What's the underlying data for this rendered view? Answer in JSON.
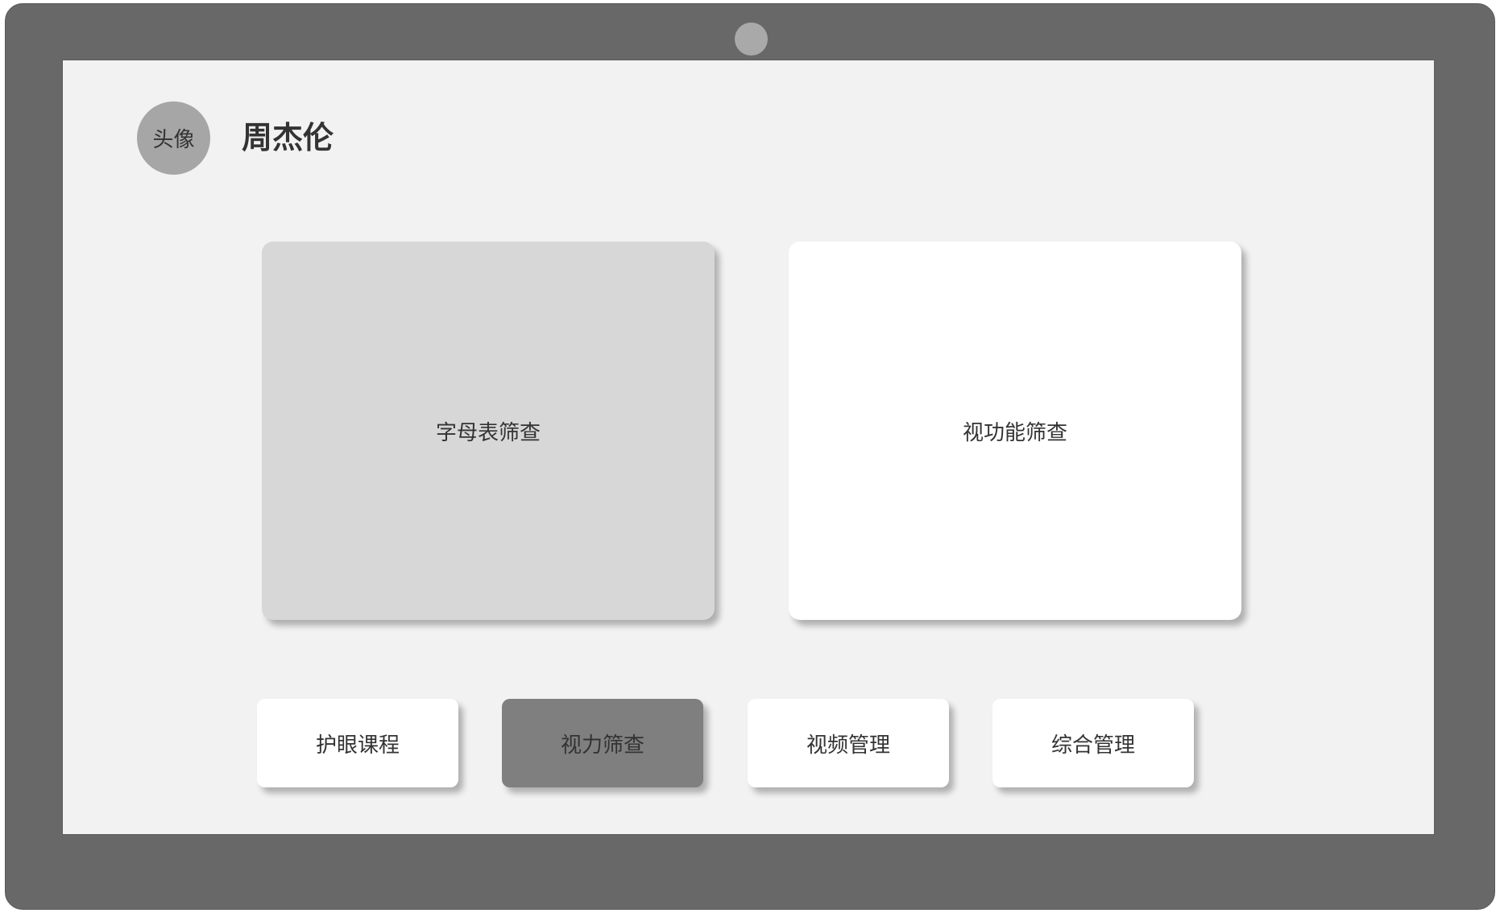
{
  "header": {
    "avatar_label": "头像",
    "username": "周杰伦"
  },
  "cards": [
    {
      "label": "字母表筛查",
      "state": "selected"
    },
    {
      "label": "视功能筛查",
      "state": "default"
    }
  ],
  "nav": [
    {
      "label": "护眼课程",
      "active": false
    },
    {
      "label": "视力筛查",
      "active": true
    },
    {
      "label": "视频管理",
      "active": false
    },
    {
      "label": "综合管理",
      "active": false
    }
  ],
  "colors": {
    "device_frame": "#686868",
    "screen_bg": "#f2f2f2",
    "camera": "#a9a9a9",
    "avatar_bg": "#a6a6a6",
    "card_selected": "#d7d7d7",
    "card_default": "#ffffff",
    "nav_active": "#7f7f7f",
    "text": "#333333"
  }
}
